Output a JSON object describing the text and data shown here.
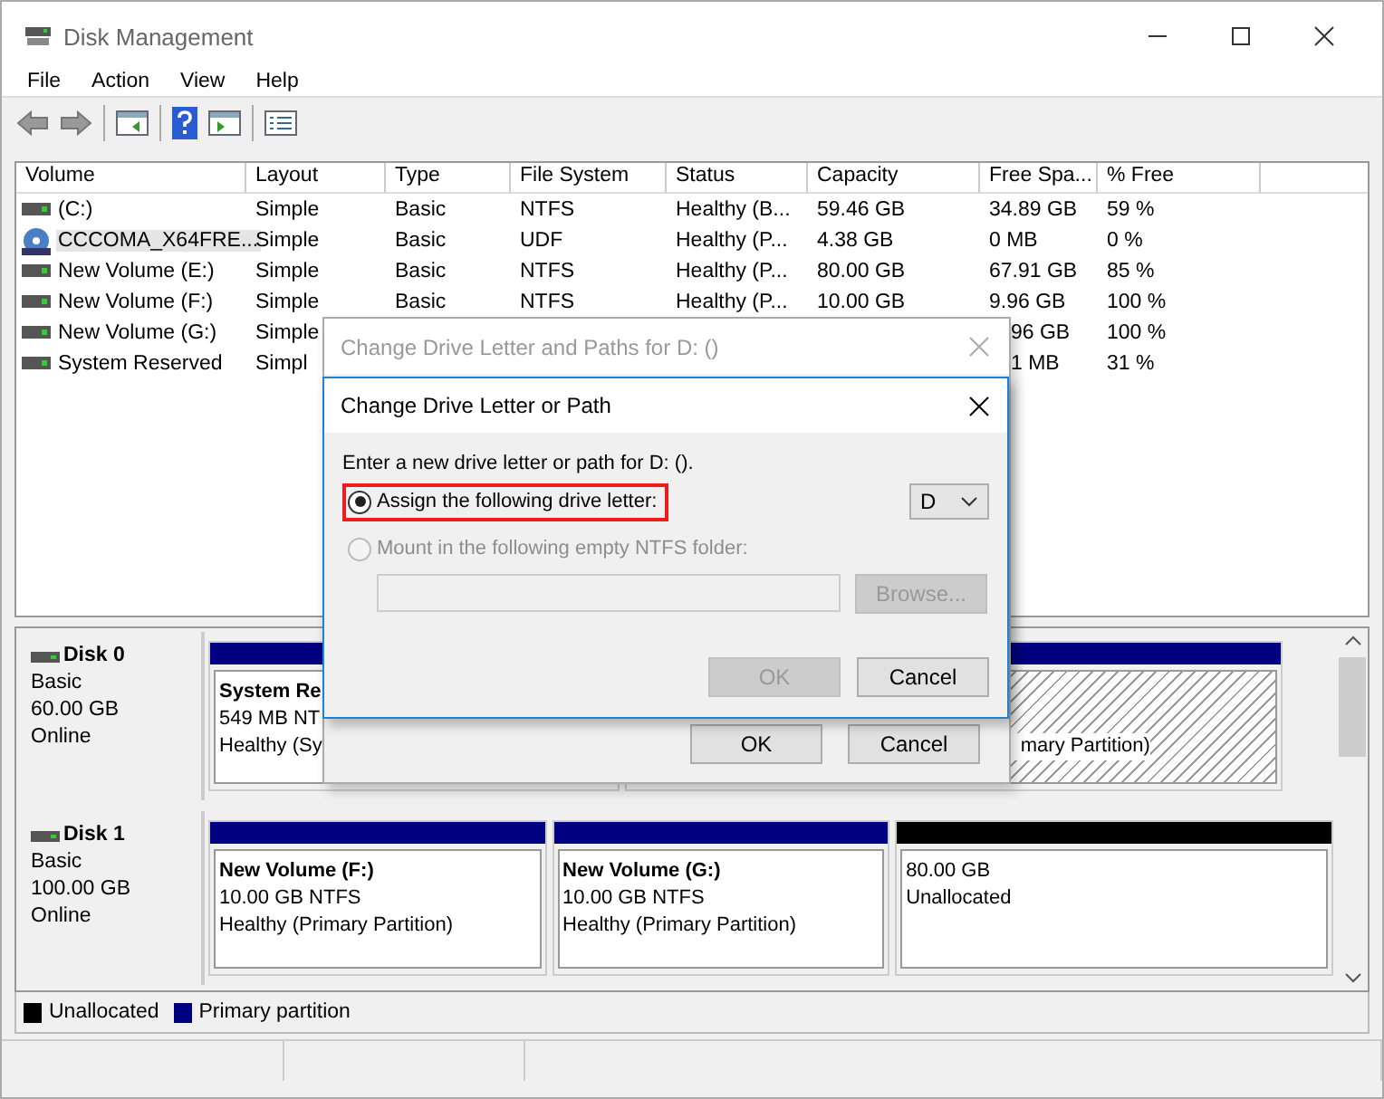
{
  "window": {
    "title": "Disk Management"
  },
  "menu": [
    "File",
    "Action",
    "View",
    "Help"
  ],
  "volumes": {
    "columns": [
      "Volume",
      "Layout",
      "Type",
      "File System",
      "Status",
      "Capacity",
      "Free Spa...",
      "% Free"
    ],
    "rows": [
      {
        "kind": "drive",
        "selected": false,
        "cells": [
          "(C:)",
          "Simple",
          "Basic",
          "NTFS",
          "Healthy (B...",
          "59.46 GB",
          "34.89 GB",
          "59 %"
        ]
      },
      {
        "kind": "disc",
        "selected": true,
        "cells": [
          "CCCOMA_X64FRE...",
          "Simple",
          "Basic",
          "UDF",
          "Healthy (P...",
          "4.38 GB",
          "0 MB",
          "0 %"
        ]
      },
      {
        "kind": "drive",
        "selected": false,
        "cells": [
          "New Volume (E:)",
          "Simple",
          "Basic",
          "NTFS",
          "Healthy (P...",
          "80.00 GB",
          "67.91 GB",
          "85 %"
        ]
      },
      {
        "kind": "drive",
        "selected": false,
        "cells": [
          "New Volume (F:)",
          "Simple",
          "Basic",
          "NTFS",
          "Healthy (P...",
          "10.00 GB",
          "9.96 GB",
          "100 %"
        ]
      },
      {
        "kind": "drive",
        "selected": false,
        "cells": [
          "New Volume (G:)",
          "Simple",
          null,
          null,
          null,
          null,
          "96 GB",
          "100 %"
        ]
      },
      {
        "kind": "drive",
        "selected": false,
        "cells": [
          "System Reserved",
          "Simpl",
          null,
          null,
          null,
          null,
          "1 MB",
          "31 %"
        ]
      }
    ]
  },
  "disks": [
    {
      "name": "Disk 0",
      "type": "Basic",
      "size": "60.00 GB",
      "status": "Online",
      "partitions": [
        {
          "kind": "primary",
          "selected": false,
          "name": "System Re",
          "size": "549 MB NT",
          "status": "Healthy (Sy"
        },
        {
          "kind": "primary",
          "selected": true,
          "status": "mary Partition)"
        }
      ]
    },
    {
      "name": "Disk 1",
      "type": "Basic",
      "size": "100.00 GB",
      "status": "Online",
      "partitions": [
        {
          "kind": "primary",
          "selected": false,
          "name": "New Volume  (F:)",
          "size": "10.00 GB NTFS",
          "status": "Healthy (Primary Partition)"
        },
        {
          "kind": "primary",
          "selected": false,
          "name": "New Volume  (G:)",
          "size": "10.00 GB NTFS",
          "status": "Healthy (Primary Partition)"
        },
        {
          "kind": "unallocated",
          "selected": false,
          "size": "80.00 GB",
          "status": "Unallocated"
        }
      ]
    }
  ],
  "legend": [
    {
      "label": "Unallocated",
      "color": "#000000"
    },
    {
      "label": "Primary partition",
      "color": "#000080"
    }
  ],
  "background_dialog": {
    "title": "Change Drive Letter and Paths for D: ()",
    "buttons": [
      "OK",
      "Cancel"
    ]
  },
  "dialog": {
    "title": "Change Drive Letter or Path",
    "prompt": "Enter a new drive letter or path for D: ().",
    "options": [
      {
        "label": "Assign the following drive letter:",
        "selected": true,
        "disabled": false,
        "highlighted": true
      },
      {
        "label": "Mount in the following empty NTFS folder:",
        "selected": false,
        "disabled": true,
        "highlighted": false
      }
    ],
    "drive_letter": "D",
    "folder_field": {
      "disabled": true
    },
    "browse": {
      "label": "Browse...",
      "disabled": true
    },
    "buttons": [
      {
        "label": "OK",
        "disabled": true
      },
      {
        "label": "Cancel",
        "disabled": false
      }
    ]
  }
}
